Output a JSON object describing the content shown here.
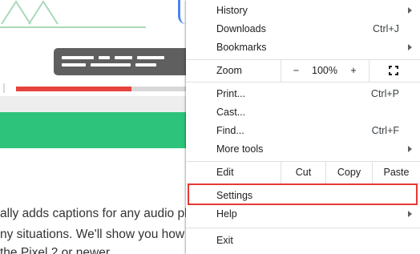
{
  "background_page": {
    "article_lines": [
      "ally adds captions for any audio playing on your phone",
      "ny situations. We'll show you how",
      "the Pixel 2 or newer"
    ],
    "progress_fraction": 0.68,
    "colors": {
      "brand_green": "#2ec37a",
      "progress_red": "#e5433b",
      "toast_bg": "#5f5f5f"
    }
  },
  "menu": {
    "history": {
      "label": "History"
    },
    "downloads": {
      "label": "Downloads",
      "shortcut": "Ctrl+J"
    },
    "bookmarks": {
      "label": "Bookmarks"
    },
    "zoom": {
      "label": "Zoom",
      "minus": "−",
      "level": "100%",
      "plus": "+",
      "fullscreen_icon": "fullscreen-icon"
    },
    "print": {
      "label": "Print...",
      "shortcut": "Ctrl+P"
    },
    "cast": {
      "label": "Cast..."
    },
    "find": {
      "label": "Find...",
      "shortcut": "Ctrl+F"
    },
    "more_tools": {
      "label": "More tools"
    },
    "edit": {
      "label": "Edit",
      "cut": "Cut",
      "copy": "Copy",
      "paste": "Paste"
    },
    "settings": {
      "label": "Settings",
      "highlight_color": "#e53935"
    },
    "help": {
      "label": "Help"
    },
    "exit": {
      "label": "Exit"
    }
  }
}
